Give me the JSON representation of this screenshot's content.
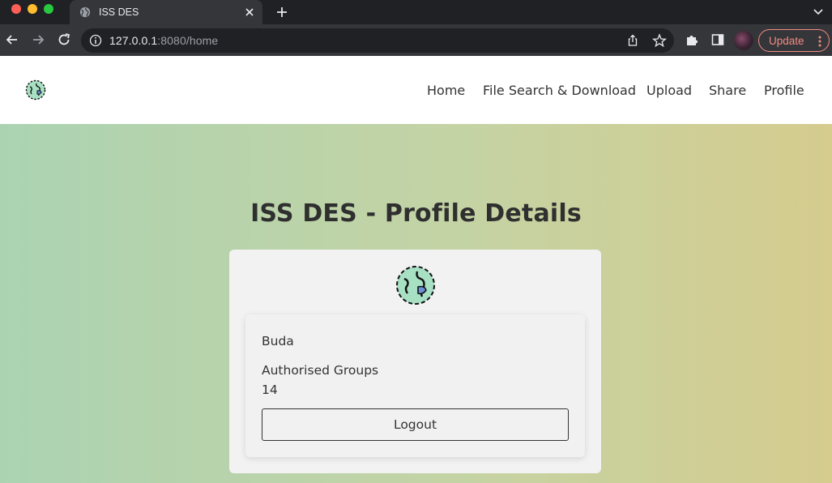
{
  "browser": {
    "tab_title": "ISS DES",
    "url_host": "127.0.0.1",
    "url_rest": ":8080/home",
    "update_label": "Update",
    "icons": [
      "globe-icon",
      "close-icon",
      "plus-icon",
      "chevron-down-icon",
      "back-icon",
      "forward-icon",
      "reload-icon",
      "info-icon",
      "share-icon",
      "star-icon",
      "puzzle-icon",
      "sidebar-icon",
      "kebab-menu-icon"
    ]
  },
  "nav": {
    "links": [
      "Home",
      "File Search & Download",
      "Upload",
      "Share",
      "Profile"
    ]
  },
  "page": {
    "title": "ISS DES - Profile Details"
  },
  "profile": {
    "username": "Buda",
    "groups_label": "Authorised Groups",
    "groups_value": "14",
    "logout_label": "Logout"
  },
  "colors": {
    "gradient_start": "#abd3b2",
    "gradient_end": "#d5cc8e",
    "card_bg": "#f2f2f2",
    "update_accent": "#f28b82"
  }
}
